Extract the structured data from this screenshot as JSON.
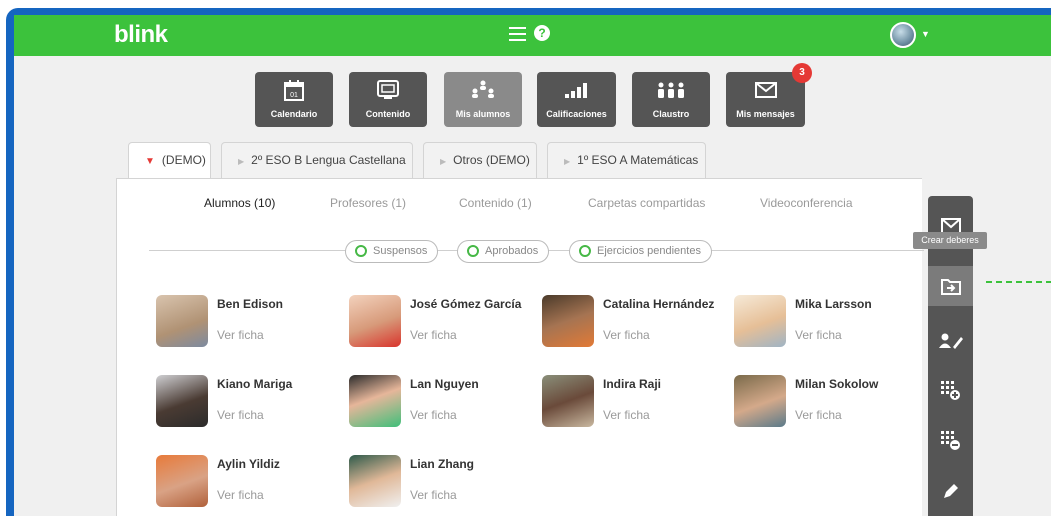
{
  "app": {
    "logo": "blink",
    "help": "?"
  },
  "nav": [
    {
      "label": "Calendario",
      "icon": "calendar-icon",
      "day": "01"
    },
    {
      "label": "Contenido",
      "icon": "content-icon"
    },
    {
      "label": "Mis alumnos",
      "icon": "students-icon",
      "active": true
    },
    {
      "label": "Calificaciones",
      "icon": "grades-icon"
    },
    {
      "label": "Claustro",
      "icon": "staff-icon"
    },
    {
      "label": "Mis mensajes",
      "icon": "mail-icon",
      "badge": "3"
    }
  ],
  "class_tabs": [
    "(DEMO)",
    "2º ESO B Lengua Castellana",
    "Otros (DEMO)",
    "1º ESO A Matemáticas"
  ],
  "sub_tabs": [
    "Alumnos (10)",
    "Profesores (1)",
    "Contenido (1)",
    "Carpetas compartidas",
    "Videoconferencia"
  ],
  "filters": [
    "Suspensos",
    "Aprobados",
    "Ejercicios pendientes"
  ],
  "view_link": "Ver ficha",
  "students": [
    {
      "name": "Ben Edison"
    },
    {
      "name": "José Gómez García"
    },
    {
      "name": "Catalina Hernández"
    },
    {
      "name": "Mika Larsson"
    },
    {
      "name": "Kiano Mariga"
    },
    {
      "name": "Lan Nguyen"
    },
    {
      "name": "Indira Raji"
    },
    {
      "name": "Milan Sokolow"
    },
    {
      "name": "Aylin Yildiz"
    },
    {
      "name": "Lian Zhang"
    }
  ],
  "rail": {
    "tooltip": "Crear deberes",
    "icons": [
      "mail-icon",
      "assign-homework-icon",
      "edit-user-icon",
      "grid-add-icon",
      "grid-remove-icon",
      "pencil-icon"
    ]
  },
  "colors": {
    "topbar": "#3cc23c",
    "frame": "#1565c0",
    "nav": "#555555",
    "badge": "#e53935"
  }
}
